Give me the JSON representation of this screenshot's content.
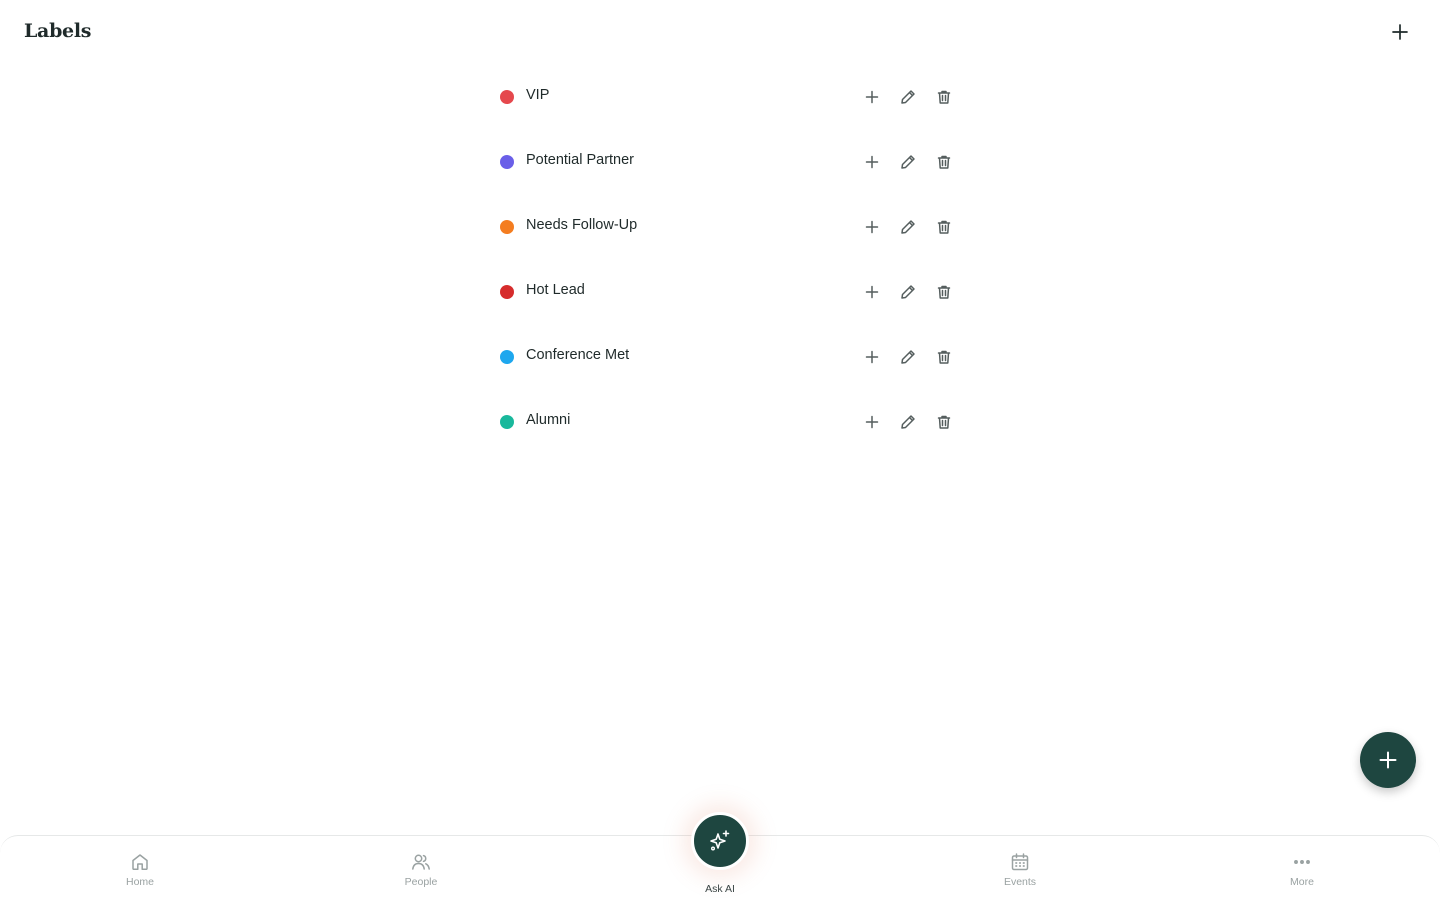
{
  "header": {
    "title": "Labels",
    "add_icon": "plus-icon"
  },
  "labels": [
    {
      "name": "VIP",
      "color": "#e5484d"
    },
    {
      "name": "Potential Partner",
      "color": "#6a5fe8"
    },
    {
      "name": "Needs Follow-Up",
      "color": "#f47d20"
    },
    {
      "name": "Hot Lead",
      "color": "#d62c2c"
    },
    {
      "name": "Conference Met",
      "color": "#1ea7ee"
    },
    {
      "name": "Alumni",
      "color": "#19b89c"
    }
  ],
  "row_actions": [
    "plus-icon",
    "pencil-icon",
    "trash-icon"
  ],
  "fab": {
    "icon": "plus-icon",
    "color": "#1e4640"
  },
  "bottom_nav": {
    "items": [
      {
        "label": "Home",
        "icon": "home-icon"
      },
      {
        "label": "People",
        "icon": "people-icon"
      },
      {
        "label": "Ask AI",
        "icon": "sparkle-icon"
      },
      {
        "label": "Events",
        "icon": "calendar-icon"
      },
      {
        "label": "More",
        "icon": "more-icon"
      }
    ]
  }
}
